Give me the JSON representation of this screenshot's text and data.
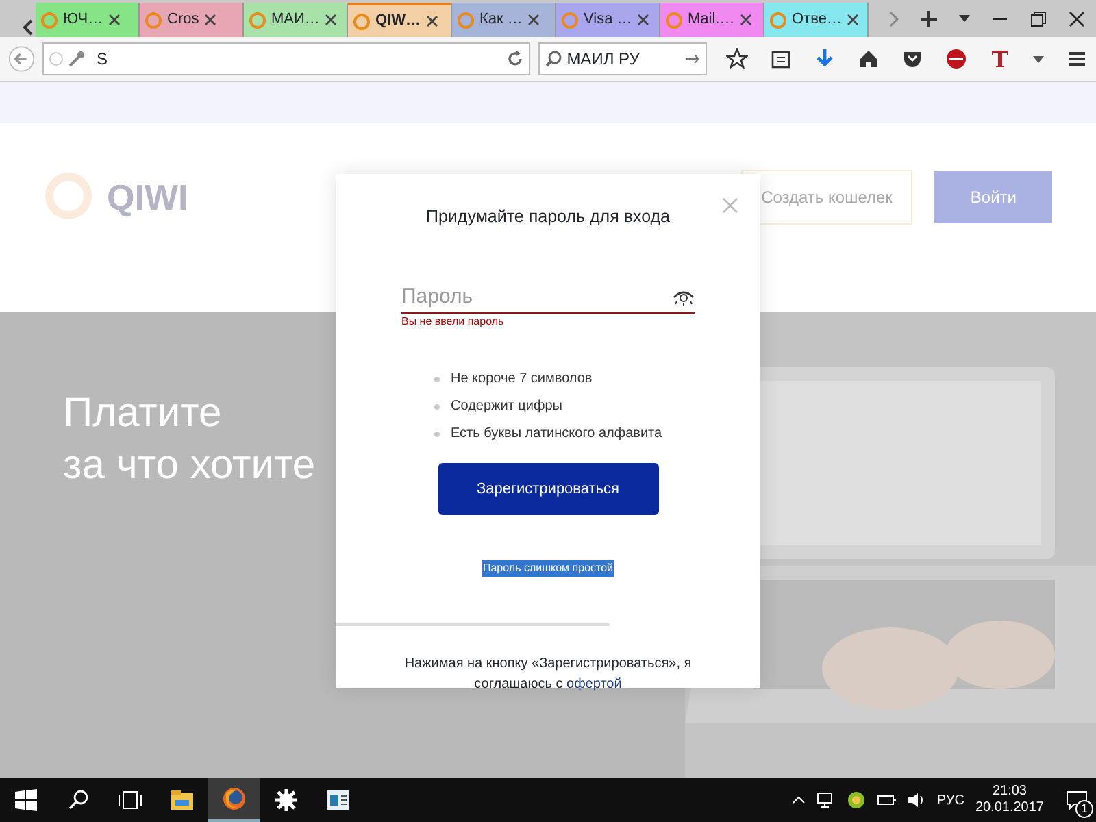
{
  "browser": {
    "tabs": [
      {
        "title": "ЮЧ…",
        "color": "#86e486",
        "selected": false
      },
      {
        "title": "Cros",
        "color": "#e6a6b4",
        "selected": false
      },
      {
        "title": "МАИ…",
        "color": "#a9e2a9",
        "selected": false
      },
      {
        "title": "QIW…",
        "color": "#f3cfa6",
        "selected": true
      },
      {
        "title": "Как …",
        "color": "#a6b4da",
        "selected": false
      },
      {
        "title": "Visa …",
        "color": "#a9a6ee",
        "selected": false
      },
      {
        "title": "Mail.…",
        "color": "#f08af0",
        "selected": false
      },
      {
        "title": "Отве…",
        "color": "#86e8ee",
        "selected": false
      }
    ],
    "address": "S",
    "search": "МАИЛ РУ"
  },
  "page": {
    "logo": "QIWI",
    "create_wallet": "Создать кошелек",
    "login": "Войти",
    "hero_lines": [
      "Платите",
      "за что хотите"
    ]
  },
  "modal": {
    "title": "Придумайте пароль для входа",
    "password": {
      "placeholder": "Пароль",
      "error": "Вы не ввели пароль"
    },
    "rules": [
      "Не короче 7 символов",
      "Содержит цифры",
      "Есть буквы латинского алфавита"
    ],
    "button": "Зарегистрироваться",
    "selected_text": "Пароль слишком простой",
    "footer": "Нажимая на кнопку «Зарегистрироваться», я соглашаюсь с",
    "footer_link": "офертой"
  },
  "taskbar": {
    "apps": [
      {
        "kind": "explorer",
        "selected": false
      },
      {
        "kind": "firefox",
        "selected": true
      },
      {
        "kind": "settings",
        "selected": false
      },
      {
        "kind": "window",
        "selected": false
      }
    ],
    "language": "РУС",
    "time": "21:03",
    "date": "20.01.2017",
    "notifications": "1"
  }
}
